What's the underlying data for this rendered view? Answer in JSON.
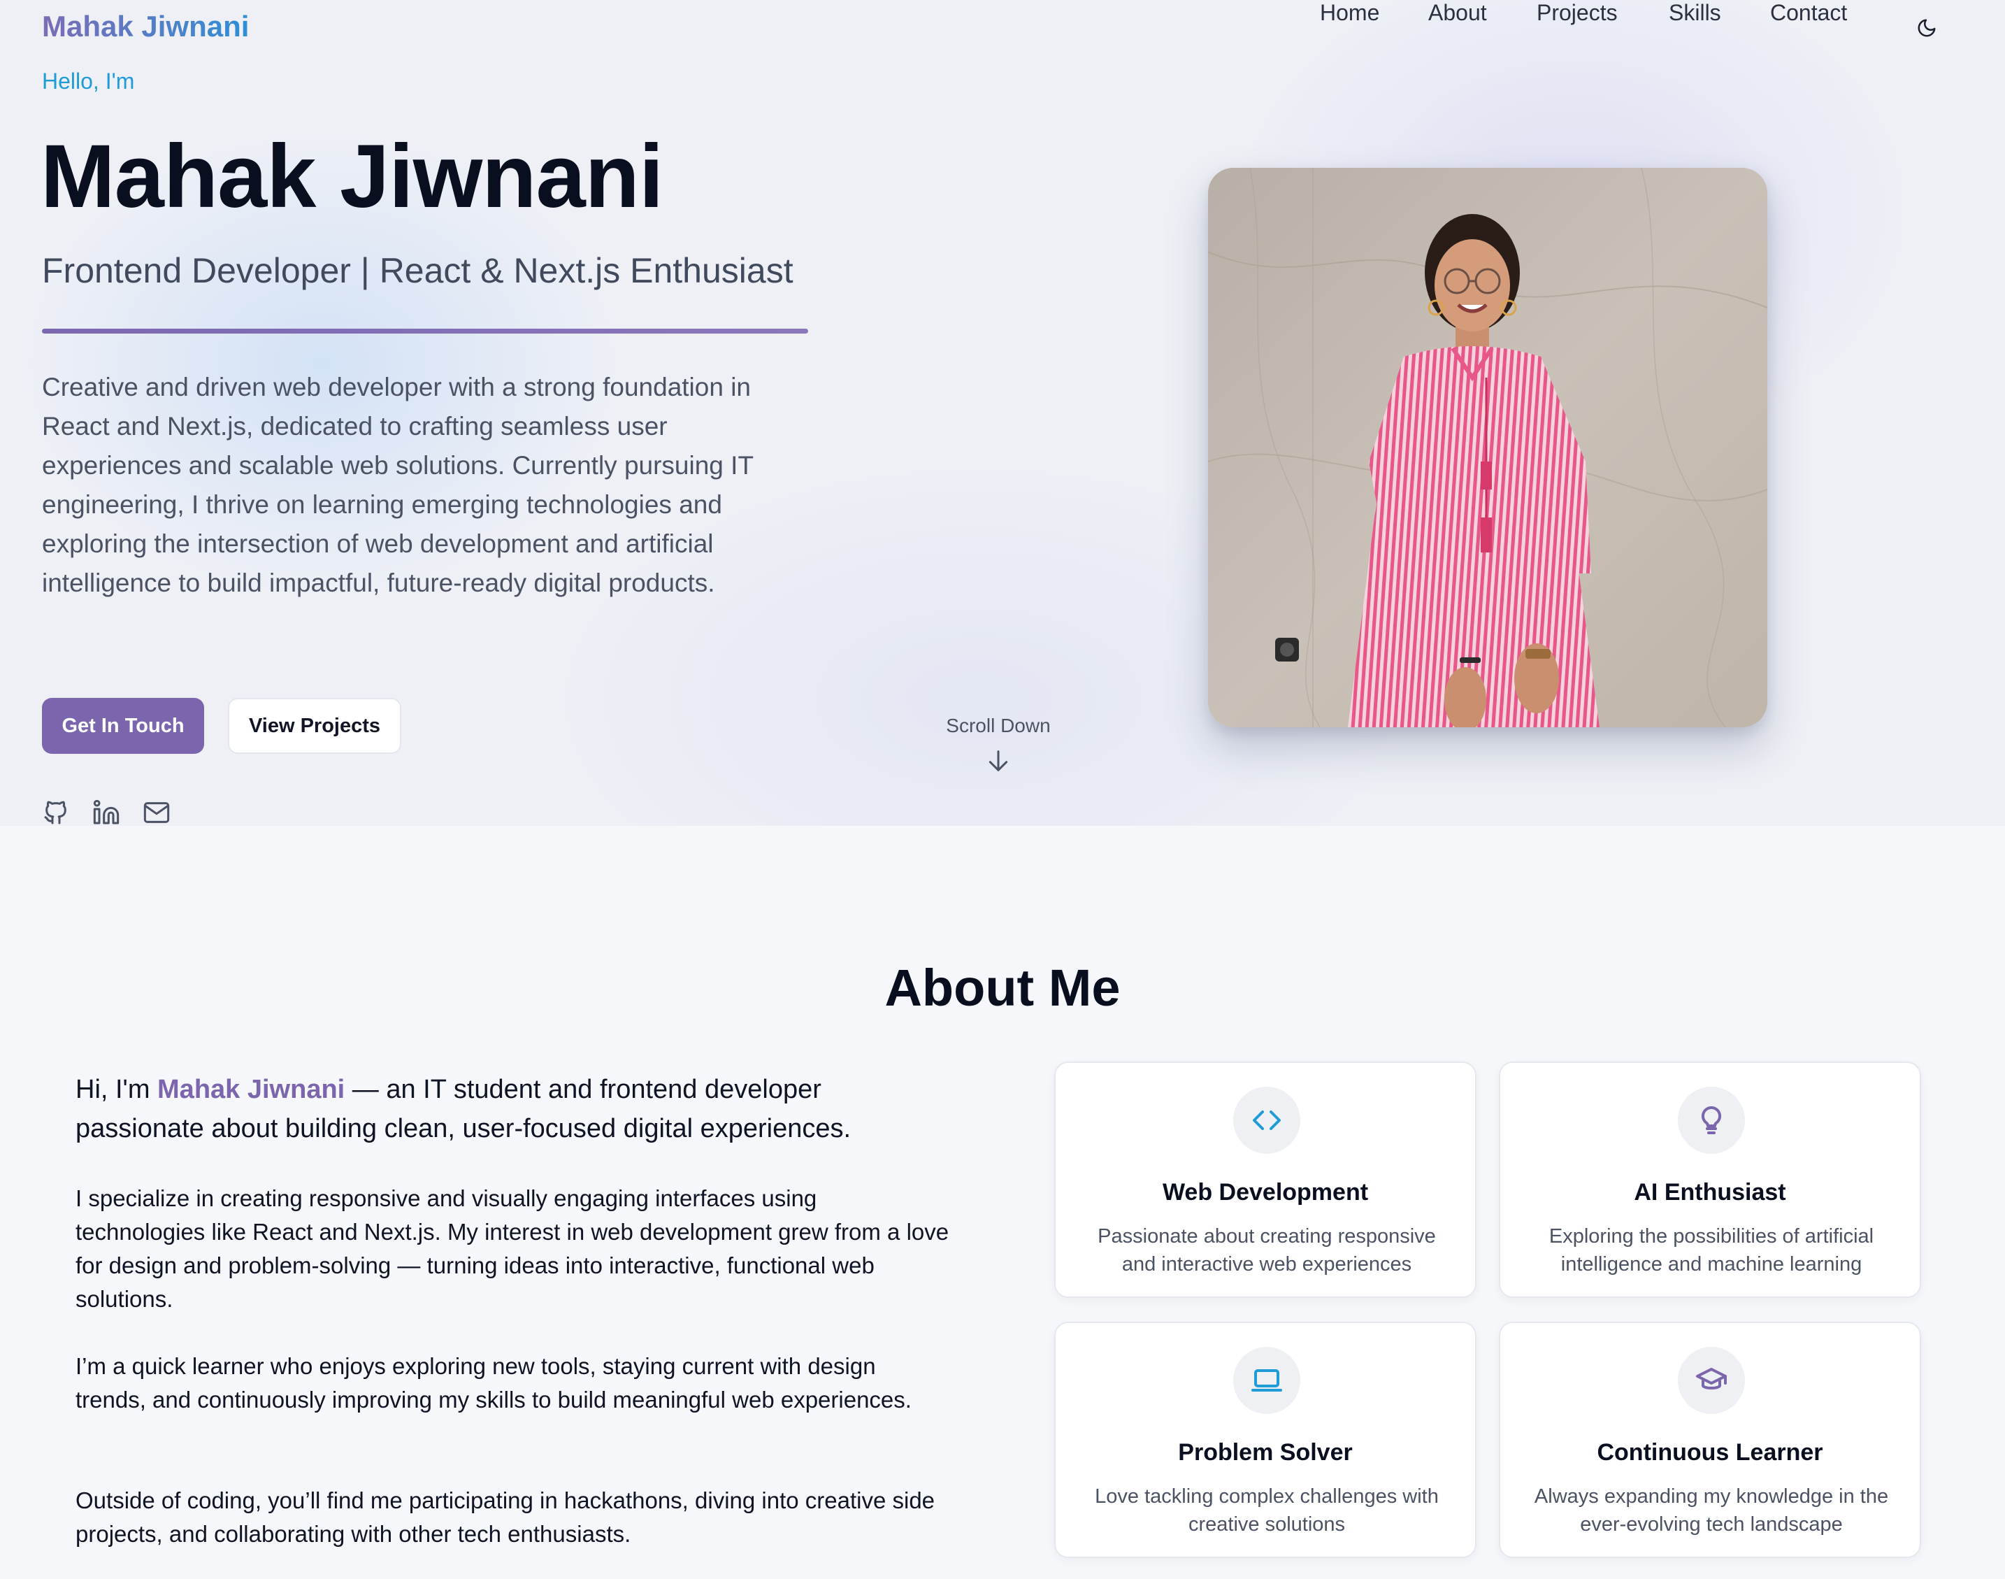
{
  "header": {
    "brand": "Mahak Jiwnani",
    "nav": [
      "Home",
      "About",
      "Projects",
      "Skills",
      "Contact"
    ],
    "theme_icon": "moon-icon"
  },
  "hero": {
    "greeting": "Hello, I'm",
    "name": "Mahak Jiwnani",
    "role": "Frontend Developer | React & Next.js Enthusiast",
    "description": "Creative and driven web developer with a strong foundation in React and Next.js, dedicated to crafting seamless user experiences and scalable web solutions. Currently pursuing IT engineering, I thrive on learning emerging technologies and exploring the intersection of web development and artificial intelligence to build impactful, future-ready digital products.",
    "primary_button": "Get In Touch",
    "secondary_button": "View Projects",
    "scroll_label": "Scroll Down",
    "social_icons": [
      "github-icon",
      "linkedin-icon",
      "mail-icon"
    ]
  },
  "about": {
    "title": "About Me",
    "intro_prefix": "Hi, I'm ",
    "intro_name": "Mahak Jiwnani",
    "intro_suffix": " — an IT student and frontend developer passionate about building clean, user-focused digital experiences.",
    "paragraphs": [
      "I specialize in creating responsive and visually engaging interfaces using technologies like React and Next.js. My interest in web development grew from a love for design and problem-solving — turning ideas into interactive, functional web solutions.",
      "I’m a quick learner who enjoys exploring new tools, staying current with design trends, and continuously improving my skills to build meaningful web experiences.",
      "Outside of coding, you’ll find me participating in hackathons, diving into creative side projects, and collaborating with other tech enthusiasts."
    ],
    "cards": [
      {
        "icon": "code-icon",
        "title": "Web Development",
        "desc": "Passionate about creating responsive and interactive web experiences"
      },
      {
        "icon": "lightbulb-icon",
        "title": "AI Enthusiast",
        "desc": "Exploring the possibilities of artificial intelligence and machine learning"
      },
      {
        "icon": "laptop-icon",
        "title": "Problem Solver",
        "desc": "Love tackling complex challenges with creative solutions"
      },
      {
        "icon": "graduation-cap-icon",
        "title": "Continuous Learner",
        "desc": "Always expanding my knowledge in the ever-evolving tech landscape"
      }
    ]
  },
  "colors": {
    "accent": "#7b65ad",
    "link_blue": "#1f9bd8",
    "icon_blue": "#1f9bd8",
    "icon_purple": "#7b65ad"
  }
}
